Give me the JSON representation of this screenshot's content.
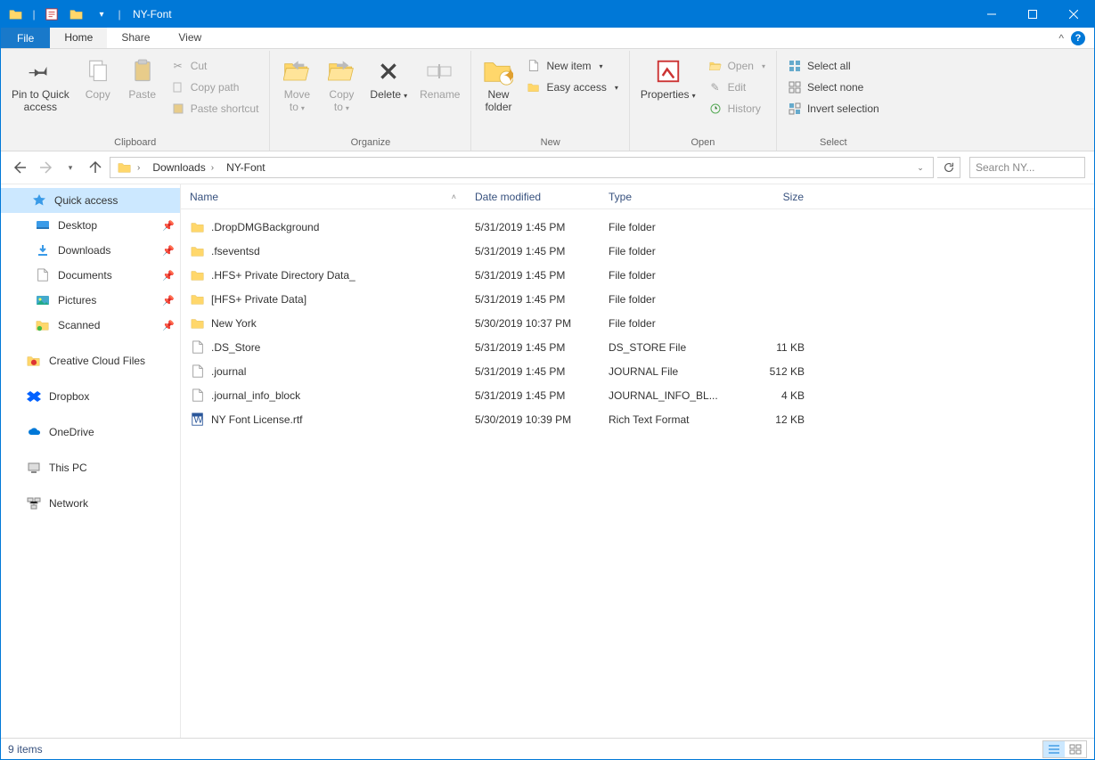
{
  "window": {
    "title": "NY-Font"
  },
  "tabs": {
    "file": "File",
    "home": "Home",
    "share": "Share",
    "view": "View"
  },
  "ribbon": {
    "clipboard": {
      "label": "Clipboard",
      "pin": "Pin to Quick\naccess",
      "copy": "Copy",
      "paste": "Paste",
      "cut": "Cut",
      "copy_path": "Copy path",
      "paste_shortcut": "Paste shortcut"
    },
    "organize": {
      "label": "Organize",
      "move_to": "Move\nto",
      "copy_to": "Copy\nto",
      "delete": "Delete",
      "rename": "Rename"
    },
    "new": {
      "label": "New",
      "new_folder": "New\nfolder",
      "new_item": "New item",
      "easy_access": "Easy access"
    },
    "open": {
      "label": "Open",
      "properties": "Properties",
      "open": "Open",
      "edit": "Edit",
      "history": "History"
    },
    "select": {
      "label": "Select",
      "select_all": "Select all",
      "select_none": "Select none",
      "invert": "Invert selection"
    }
  },
  "breadcrumbs": [
    "Downloads",
    "NY-Font"
  ],
  "search_placeholder": "Search NY...",
  "sidebar": {
    "quick_access": "Quick access",
    "pinned": [
      {
        "label": "Desktop",
        "icon": "desktop"
      },
      {
        "label": "Downloads",
        "icon": "downloads"
      },
      {
        "label": "Documents",
        "icon": "documents"
      },
      {
        "label": "Pictures",
        "icon": "pictures"
      },
      {
        "label": "Scanned",
        "icon": "folder-green"
      }
    ],
    "others": [
      {
        "label": "Creative Cloud Files",
        "icon": "cc"
      },
      {
        "label": "Dropbox",
        "icon": "dropbox"
      },
      {
        "label": "OneDrive",
        "icon": "onedrive"
      },
      {
        "label": "This PC",
        "icon": "thispc"
      },
      {
        "label": "Network",
        "icon": "network"
      }
    ]
  },
  "columns": {
    "name": "Name",
    "date": "Date modified",
    "type": "Type",
    "size": "Size"
  },
  "files": [
    {
      "name": ".DropDMGBackground",
      "date": "5/31/2019 1:45 PM",
      "type": "File folder",
      "size": "",
      "icon": "folder"
    },
    {
      "name": ".fseventsd",
      "date": "5/31/2019 1:45 PM",
      "type": "File folder",
      "size": "",
      "icon": "folder"
    },
    {
      "name": ".HFS+ Private Directory Data_",
      "date": "5/31/2019 1:45 PM",
      "type": "File folder",
      "size": "",
      "icon": "folder"
    },
    {
      "name": "[HFS+ Private Data]",
      "date": "5/31/2019 1:45 PM",
      "type": "File folder",
      "size": "",
      "icon": "folder"
    },
    {
      "name": "New York",
      "date": "5/30/2019 10:37 PM",
      "type": "File folder",
      "size": "",
      "icon": "folder"
    },
    {
      "name": ".DS_Store",
      "date": "5/31/2019 1:45 PM",
      "type": "DS_STORE File",
      "size": "11 KB",
      "icon": "file"
    },
    {
      "name": ".journal",
      "date": "5/31/2019 1:45 PM",
      "type": "JOURNAL File",
      "size": "512 KB",
      "icon": "file"
    },
    {
      "name": ".journal_info_block",
      "date": "5/31/2019 1:45 PM",
      "type": "JOURNAL_INFO_BL...",
      "size": "4 KB",
      "icon": "file"
    },
    {
      "name": "NY Font License.rtf",
      "date": "5/30/2019 10:39 PM",
      "type": "Rich Text Format",
      "size": "12 KB",
      "icon": "rtf"
    }
  ],
  "status": {
    "count": "9 items"
  }
}
